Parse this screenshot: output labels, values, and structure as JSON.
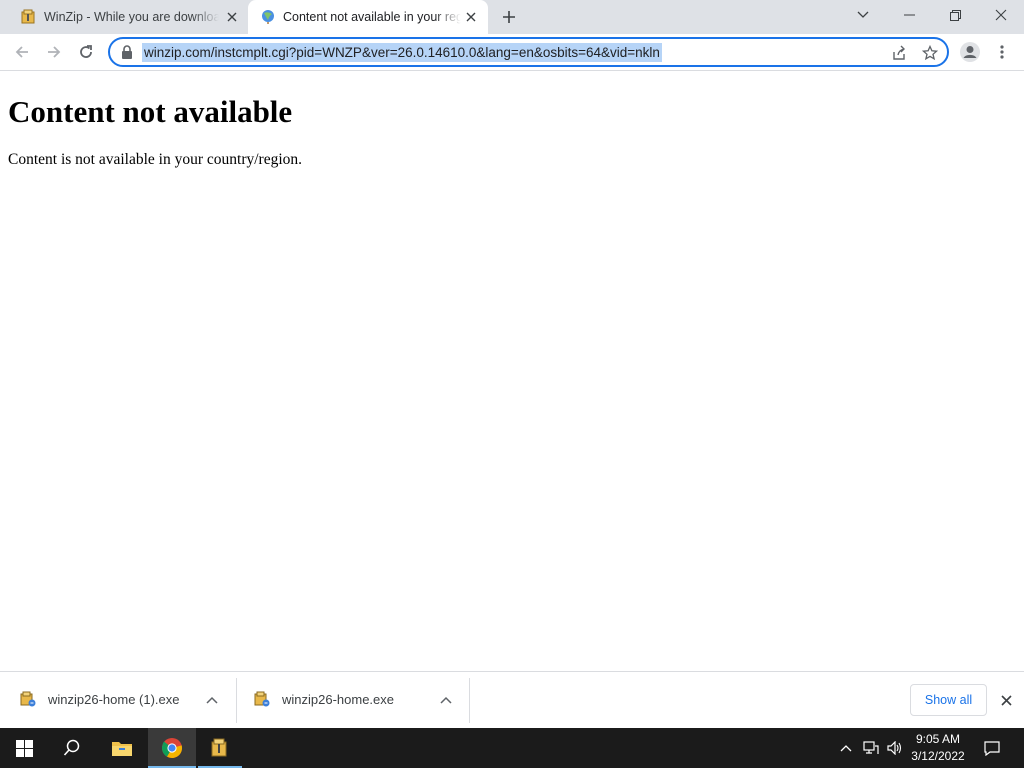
{
  "browser": {
    "tabs": [
      {
        "title": "WinZip - While you are downloading",
        "favicon": "winzip-icon",
        "active": false
      },
      {
        "title": "Content not available in your region",
        "favicon": "globe-icon",
        "active": true
      }
    ],
    "address_bar": {
      "url": "winzip.com/instcmplt.cgi?pid=WNZP&ver=26.0.14610.0&lang=en&osbits=64&vid=nkln",
      "selected": true
    }
  },
  "page": {
    "heading": "Content not available",
    "message": "Content is not available in your country/region."
  },
  "downloads": {
    "items": [
      {
        "filename": "winzip26-home (1).exe",
        "icon": "winzip-installer-icon"
      },
      {
        "filename": "winzip26-home.exe",
        "icon": "winzip-installer-icon"
      }
    ],
    "show_all_label": "Show all"
  },
  "taskbar": {
    "apps": [
      "start-icon",
      "search-icon",
      "file-explorer-icon",
      "chrome-icon",
      "winzip-icon"
    ],
    "time": "9:05 AM",
    "date": "3/12/2022"
  },
  "colors": {
    "accent": "#1a73e8",
    "tabstrip": "#dee1e6",
    "url_selection": "#b6d4f7",
    "taskbar": "#1b1b1b"
  }
}
